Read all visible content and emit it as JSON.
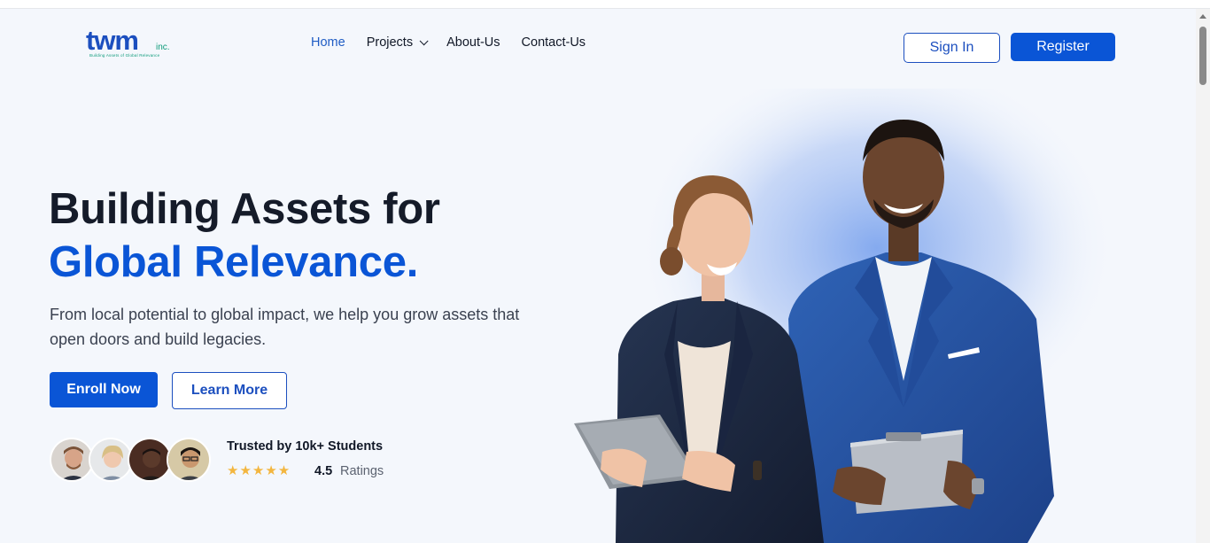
{
  "brand": {
    "logo_text": "twm",
    "logo_suffix": "inc.",
    "tagline": "Building Assets of Global Relevance"
  },
  "nav": {
    "items": [
      {
        "label": "Home",
        "active": true
      },
      {
        "label": "Projects",
        "has_dropdown": true
      },
      {
        "label": "About-Us"
      },
      {
        "label": "Contact-Us"
      }
    ]
  },
  "auth": {
    "signin_label": "Sign In",
    "register_label": "Register"
  },
  "hero": {
    "title_line1": "Building Assets for",
    "title_line2": "Global Relevance.",
    "subtitle": "From local potential to global impact, we help you grow assets that open doors and build legacies.",
    "enroll_label": "Enroll Now",
    "learn_label": "Learn More"
  },
  "trust": {
    "title": "Trusted by 10k+ Students",
    "stars": "★★★★★",
    "rating": "4.5",
    "rating_label": "Ratings"
  },
  "colors": {
    "primary": "#0a55d6",
    "brand_blue": "#1c4fbf",
    "brand_green": "#0d9b7a",
    "background": "#f4f7fc",
    "star": "#f3b63f"
  },
  "icons": {
    "projects_dropdown": "chevron-down-icon"
  }
}
